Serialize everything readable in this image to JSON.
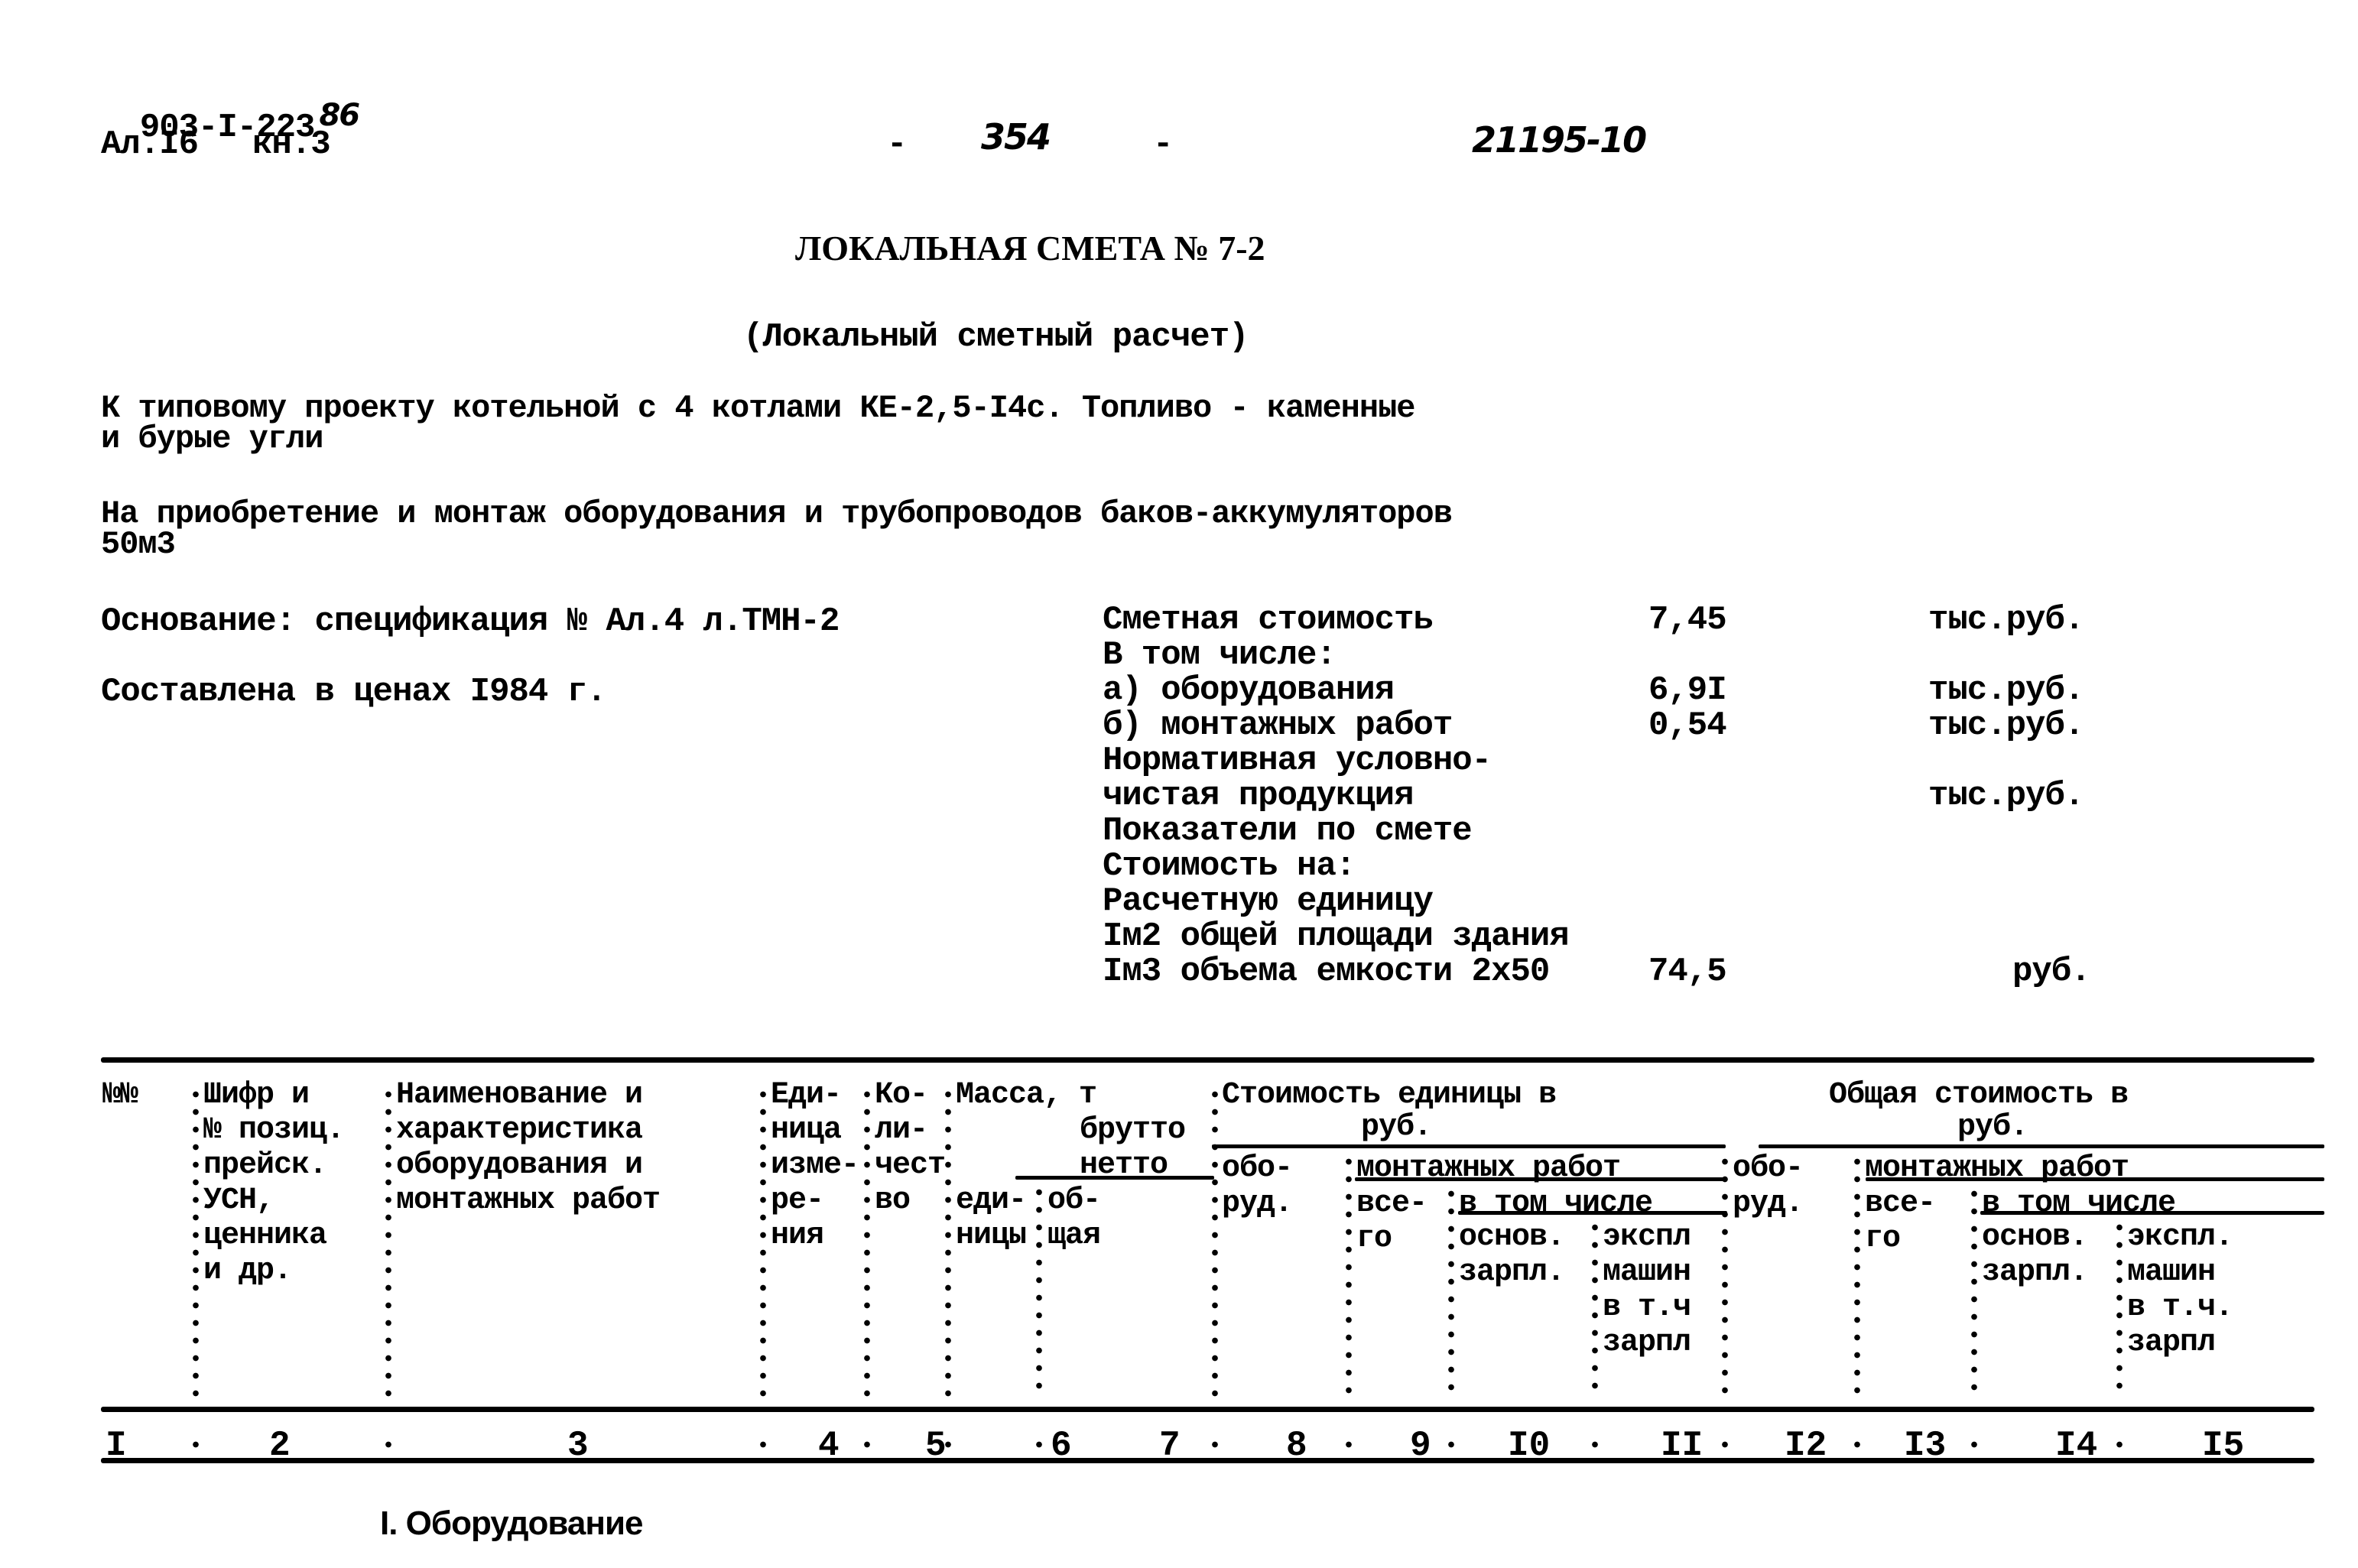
{
  "header": {
    "project_code": "903-I-223",
    "project_code_suffix": "86",
    "album": "Ал.I6",
    "book": "кн.3",
    "dash_left": "-",
    "page_number": "354",
    "dash_right": "-",
    "archive_number": "21195-10"
  },
  "title": {
    "main": "ЛОКАЛЬНАЯ СМЕТА № 7-2",
    "subtitle": "(Локальный сметный расчет)"
  },
  "description": {
    "project_line1": "К типовому проекту котельной с 4 котлами КЕ-2,5-I4с. Топливо - каменные",
    "project_line2": "и бурые угли",
    "purpose_line1": "На приобретение и монтаж оборудования и трубопроводов баков-аккумуляторов",
    "purpose_line2": "50м3"
  },
  "basis": {
    "foundation": "Основание: спецификация № Ал.4 л.ТМН-2",
    "prices": "Составлена в ценах I984 г."
  },
  "summary": {
    "rows": [
      {
        "label": "Сметная стоимость",
        "value": "7,45",
        "unit": "тыс.руб."
      },
      {
        "label": "В том числе:",
        "value": "",
        "unit": ""
      },
      {
        "label": "а) оборудования",
        "value": "6,9I",
        "unit": "тыс.руб."
      },
      {
        "label": "б) монтажных работ",
        "value": "0,54",
        "unit": "тыс.руб."
      },
      {
        "label": "Нормативная условно-",
        "value": "",
        "unit": ""
      },
      {
        "label": "чистая продукция",
        "value": "",
        "unit": "тыс.руб."
      },
      {
        "label": "Показатели по смете",
        "value": "",
        "unit": ""
      },
      {
        "label": "Стоимость на:",
        "value": "",
        "unit": ""
      },
      {
        "label": "Расчетную единицу",
        "value": "",
        "unit": ""
      },
      {
        "label": "Iм2 общей площади здания",
        "value": "",
        "unit": ""
      },
      {
        "label": "Iм3 объема емкости 2х50",
        "value": "74,5",
        "unit": "руб."
      }
    ]
  },
  "table": {
    "headers": {
      "col1": "№№",
      "col2": [
        "Шифр и",
        "№ позиц.",
        "прейск.",
        "УСН,",
        "ценника",
        "и др."
      ],
      "col3": [
        "Наименование и",
        "характеристика",
        "оборудования и",
        "монтажных работ"
      ],
      "col4": [
        "Еди-",
        "ница",
        "изме-",
        "ре-",
        "ния"
      ],
      "col5": [
        "Ко-",
        "ли-",
        "чест",
        "во"
      ],
      "mass_group": [
        "Масса, т",
        "брутто",
        "нетто"
      ],
      "col6": [
        "еди-",
        "ницы"
      ],
      "col7": [
        "об-",
        "щая"
      ],
      "unit_cost_group": [
        "Стоимость единицы в",
        "руб."
      ],
      "col8": [
        "обо-",
        "руд."
      ],
      "unit_install_group": "монтажных работ",
      "col9": [
        "все-",
        "го"
      ],
      "unit_incl_group": "в том числе",
      "col10": [
        "основ.",
        "зарпл."
      ],
      "col11": [
        "экспл",
        "машин",
        "в т.ч",
        "зарпл"
      ],
      "total_cost_group": [
        "Общая стоимость в",
        "руб."
      ],
      "col12": [
        "обо-",
        "руд."
      ],
      "total_install_group": "монтажных работ",
      "col13": [
        "все-",
        "го"
      ],
      "total_incl_group": "в том числе",
      "col14": [
        "основ.",
        "зарпл."
      ],
      "col15": [
        "экспл.",
        "машин",
        "в т.ч.",
        "зарпл"
      ]
    },
    "column_numbers": [
      "I",
      "2",
      "3",
      "4",
      "5",
      "6",
      "7",
      "8",
      "9",
      "I0",
      "II",
      "I2",
      "I3",
      "I4",
      "I5"
    ],
    "sections": [
      {
        "title": "I. Оборудование"
      }
    ]
  }
}
